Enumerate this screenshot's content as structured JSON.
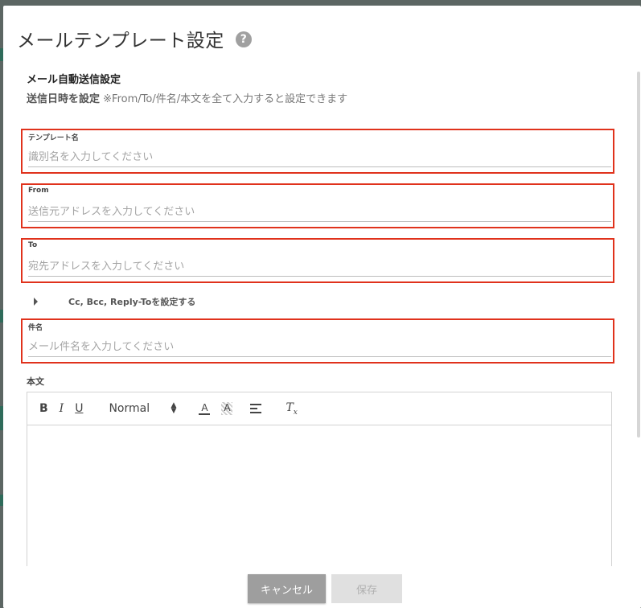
{
  "modal": {
    "title": "メールテンプレート設定",
    "help_icon": "question-circle-icon",
    "help_glyph": "?"
  },
  "auto_send": {
    "section_title": "メール自動送信設定",
    "schedule_link": "送信日時を設定",
    "schedule_note": "※From/To/件名/本文を全て入力すると設定できます"
  },
  "fields": {
    "template_name": {
      "label": "テンプレート名",
      "placeholder": "識別名を入力してください",
      "value": ""
    },
    "from": {
      "label": "From",
      "placeholder": "送信元アドレスを入力してください",
      "value": ""
    },
    "to": {
      "label": "To",
      "placeholder": "宛先アドレスを入力してください",
      "value": ""
    },
    "subject": {
      "label": "件名",
      "placeholder": "メール件名を入力してください",
      "value": ""
    }
  },
  "cc_toggle": {
    "label": "Cc, Bcc, Reply-Toを設定する",
    "icon": "caret-right-icon"
  },
  "body": {
    "label": "本文",
    "toolbar": {
      "bold": "B",
      "italic": "I",
      "underline": "U",
      "header_select": "Normal",
      "color": "A",
      "background": "A",
      "clean_main": "T",
      "clean_sub": "x"
    }
  },
  "footer": {
    "cancel_label": "キャンセル",
    "save_label": "保存"
  },
  "colors": {
    "highlight_border": "#e0321c",
    "cancel_bg": "#9e9e9e",
    "save_bg_disabled": "#e0e0e0"
  }
}
